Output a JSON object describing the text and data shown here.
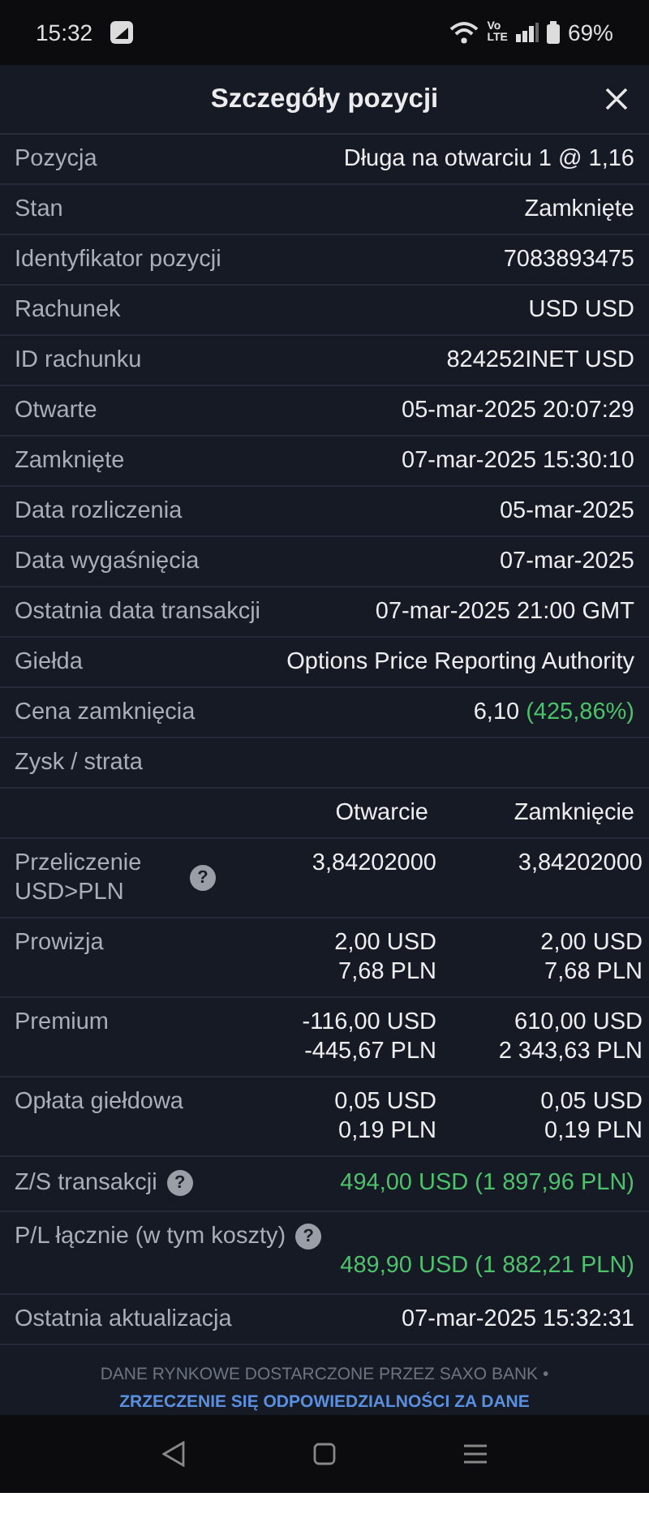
{
  "status_bar": {
    "time": "15:32",
    "volte_top": "Vo",
    "volte_bottom": "LTE",
    "battery": "69%"
  },
  "header": {
    "title": "Szczegóły pozycji"
  },
  "details": [
    {
      "label": "Pozycja",
      "value": "Długa na otwarciu 1 @ 1,16"
    },
    {
      "label": "Stan",
      "value": "Zamknięte"
    },
    {
      "label": "Identyfikator pozycji",
      "value": "7083893475"
    },
    {
      "label": "Rachunek",
      "value": "USD USD"
    },
    {
      "label": "ID rachunku",
      "value": "824252INET USD"
    },
    {
      "label": "Otwarte",
      "value": "05-mar-2025 20:07:29"
    },
    {
      "label": "Zamknięte",
      "value": "07-mar-2025 15:30:10"
    },
    {
      "label": "Data rozliczenia",
      "value": "05-mar-2025"
    },
    {
      "label": "Data wygaśnięcia",
      "value": "07-mar-2025"
    },
    {
      "label": "Ostatnia data transakcji",
      "value": "07-mar-2025 21:00 GMT"
    },
    {
      "label": "Giełda",
      "value": "Options Price Reporting Authority"
    },
    {
      "label": "Cena zamknięcia",
      "value": "6,10",
      "change": "(425,86%)"
    }
  ],
  "section_label": "Zysk / strata",
  "columns": [
    "Otwarcie",
    "Zamknięcie"
  ],
  "breakdown": [
    {
      "label": "Przeliczenie USD>PLN",
      "help": "?",
      "open": [
        "3,84202000"
      ],
      "close": [
        "3,84202000"
      ]
    },
    {
      "label": "Prowizja",
      "open": [
        "2,00 USD",
        "7,68 PLN"
      ],
      "close": [
        "2,00 USD",
        "7,68 PLN"
      ]
    },
    {
      "label": "Premium",
      "open": [
        "-116,00 USD",
        "-445,67 PLN"
      ],
      "close": [
        "610,00 USD",
        "2 343,63 PLN"
      ]
    },
    {
      "label": "Opłata giełdowa",
      "open": [
        "0,05 USD",
        "0,19 PLN"
      ],
      "close": [
        "0,05 USD",
        "0,19 PLN"
      ]
    }
  ],
  "totals": [
    {
      "kind": "inline",
      "label": "Z/S transakcji",
      "help": "?",
      "value": "494,00 USD (1 897,96 PLN)"
    },
    {
      "kind": "stacked",
      "label": "P/L łącznie (w tym koszty)",
      "help": "?",
      "value": "489,90 USD (1 882,21 PLN)"
    }
  ],
  "last_update": {
    "label": "Ostatnia aktualizacja",
    "value": "07-mar-2025 15:32:31"
  },
  "footer": {
    "text": "DANE RYNKOWE DOSTARCZONE PRZEZ SAXO BANK • ",
    "link": "ZRZECZENIE SIĘ ODPOWIEDZIALNOŚCI ZA DANE"
  }
}
